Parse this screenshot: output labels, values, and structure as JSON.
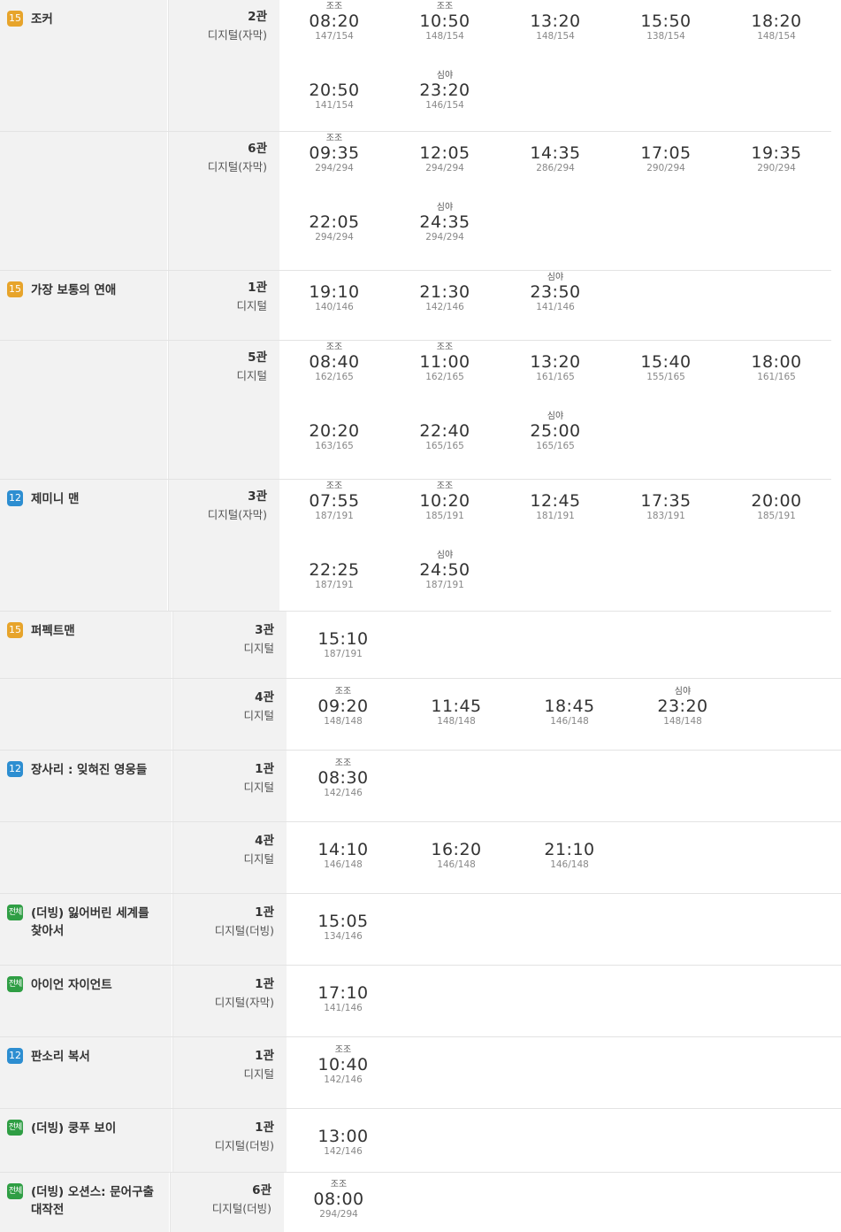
{
  "rows": [
    {
      "rating": "15",
      "rating_label": "15",
      "title": "조커",
      "hall": "2관",
      "format": "디지털(자막)",
      "slots": [
        {
          "tag": "조조",
          "time": "08:20",
          "seats": "147/154"
        },
        {
          "tag": "조조",
          "time": "10:50",
          "seats": "148/154"
        },
        {
          "tag": "",
          "time": "13:20",
          "seats": "148/154"
        },
        {
          "tag": "",
          "time": "15:50",
          "seats": "138/154"
        },
        {
          "tag": "",
          "time": "18:20",
          "seats": "148/154"
        },
        {
          "tag": "",
          "time": "20:50",
          "seats": "141/154"
        },
        {
          "tag": "심야",
          "time": "23:20",
          "seats": "146/154"
        }
      ]
    },
    {
      "rating": "",
      "rating_label": "",
      "title": "",
      "hall": "6관",
      "format": "디지털(자막)",
      "slots": [
        {
          "tag": "조조",
          "time": "09:35",
          "seats": "294/294"
        },
        {
          "tag": "",
          "time": "12:05",
          "seats": "294/294"
        },
        {
          "tag": "",
          "time": "14:35",
          "seats": "286/294"
        },
        {
          "tag": "",
          "time": "17:05",
          "seats": "290/294"
        },
        {
          "tag": "",
          "time": "19:35",
          "seats": "290/294"
        },
        {
          "tag": "",
          "time": "22:05",
          "seats": "294/294"
        },
        {
          "tag": "심야",
          "time": "24:35",
          "seats": "294/294"
        }
      ]
    },
    {
      "rating": "15",
      "rating_label": "15",
      "title": "가장 보통의 연애",
      "hall": "1관",
      "format": "디지털",
      "slots": [
        {
          "tag": "",
          "time": "19:10",
          "seats": "140/146"
        },
        {
          "tag": "",
          "time": "21:30",
          "seats": "142/146"
        },
        {
          "tag": "심야",
          "time": "23:50",
          "seats": "141/146"
        }
      ]
    },
    {
      "rating": "",
      "rating_label": "",
      "title": "",
      "hall": "5관",
      "format": "디지털",
      "slots": [
        {
          "tag": "조조",
          "time": "08:40",
          "seats": "162/165"
        },
        {
          "tag": "조조",
          "time": "11:00",
          "seats": "162/165"
        },
        {
          "tag": "",
          "time": "13:20",
          "seats": "161/165"
        },
        {
          "tag": "",
          "time": "15:40",
          "seats": "155/165"
        },
        {
          "tag": "",
          "time": "18:00",
          "seats": "161/165"
        },
        {
          "tag": "",
          "time": "20:20",
          "seats": "163/165"
        },
        {
          "tag": "",
          "time": "22:40",
          "seats": "165/165"
        },
        {
          "tag": "심야",
          "time": "25:00",
          "seats": "165/165"
        }
      ]
    },
    {
      "rating": "12",
      "rating_label": "12",
      "title": "제미니 맨",
      "hall": "3관",
      "format": "디지털(자막)",
      "slots": [
        {
          "tag": "조조",
          "time": "07:55",
          "seats": "187/191"
        },
        {
          "tag": "조조",
          "time": "10:20",
          "seats": "185/191"
        },
        {
          "tag": "",
          "time": "12:45",
          "seats": "181/191"
        },
        {
          "tag": "",
          "time": "17:35",
          "seats": "183/191"
        },
        {
          "tag": "",
          "time": "20:00",
          "seats": "185/191"
        },
        {
          "tag": "",
          "time": "22:25",
          "seats": "187/191"
        },
        {
          "tag": "심야",
          "time": "24:50",
          "seats": "187/191"
        }
      ]
    },
    {
      "rating": "15",
      "rating_label": "15",
      "title": "퍼펙트맨",
      "hall": "3관",
      "format": "디지털",
      "slots": [
        {
          "tag": "",
          "time": "15:10",
          "seats": "187/191"
        }
      ]
    },
    {
      "rating": "",
      "rating_label": "",
      "title": "",
      "hall": "4관",
      "format": "디지털",
      "slots": [
        {
          "tag": "조조",
          "time": "09:20",
          "seats": "148/148"
        },
        {
          "tag": "",
          "time": "11:45",
          "seats": "148/148"
        },
        {
          "tag": "",
          "time": "18:45",
          "seats": "146/148"
        },
        {
          "tag": "심야",
          "time": "23:20",
          "seats": "148/148"
        }
      ]
    },
    {
      "rating": "12",
      "rating_label": "12",
      "title": "장사리 : 잊혀진 영웅들",
      "hall": "1관",
      "format": "디지털",
      "slots": [
        {
          "tag": "조조",
          "time": "08:30",
          "seats": "142/146"
        }
      ]
    },
    {
      "rating": "",
      "rating_label": "",
      "title": "",
      "hall": "4관",
      "format": "디지털",
      "slots": [
        {
          "tag": "",
          "time": "14:10",
          "seats": "146/148"
        },
        {
          "tag": "",
          "time": "16:20",
          "seats": "146/148"
        },
        {
          "tag": "",
          "time": "21:10",
          "seats": "146/148"
        }
      ]
    },
    {
      "rating": "all",
      "rating_label": "전체",
      "title": "(더빙) 잃어버린 세계를 찾아서",
      "hall": "1관",
      "format": "디지털(더빙)",
      "slots": [
        {
          "tag": "",
          "time": "15:05",
          "seats": "134/146"
        }
      ]
    },
    {
      "rating": "all",
      "rating_label": "전체",
      "title": "아이언 자이언트",
      "hall": "1관",
      "format": "디지털(자막)",
      "slots": [
        {
          "tag": "",
          "time": "17:10",
          "seats": "141/146"
        }
      ]
    },
    {
      "rating": "12",
      "rating_label": "12",
      "title": "판소리 복서",
      "hall": "1관",
      "format": "디지털",
      "slots": [
        {
          "tag": "조조",
          "time": "10:40",
          "seats": "142/146"
        }
      ]
    },
    {
      "rating": "all",
      "rating_label": "전체",
      "title": "(더빙) 쿵푸 보이",
      "hall": "1관",
      "format": "디지털(더빙)",
      "slots": [
        {
          "tag": "",
          "time": "13:00",
          "seats": "142/146"
        }
      ]
    },
    {
      "rating": "all",
      "rating_label": "전체",
      "title": "(더빙) 오션스: 문어구출 대작전",
      "hall": "6관",
      "format": "디지털(더빙)",
      "slots": [
        {
          "tag": "조조",
          "time": "08:00",
          "seats": "294/294"
        }
      ]
    }
  ]
}
